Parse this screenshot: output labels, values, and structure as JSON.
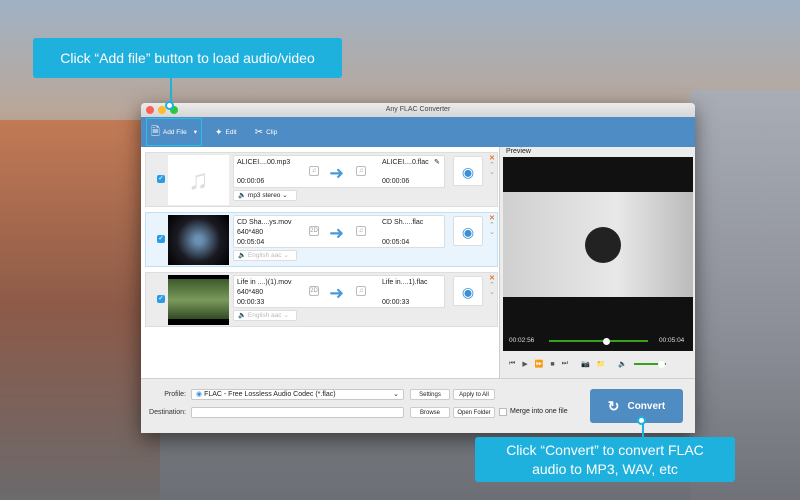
{
  "window": {
    "title": "Any FLAC Converter"
  },
  "toolbar": {
    "add_file": "Add File",
    "edit": "Edit",
    "clip": "Clip"
  },
  "files": [
    {
      "source_name": "ALICEI....00.mp3",
      "source_res": "",
      "source_duration": "00:00:06",
      "output_name": "ALICEI....0.flac",
      "output_duration": "00:00:06",
      "audio_track": "mp3 stereo",
      "checked": true,
      "thumb": "music-note-icon"
    },
    {
      "source_name": "CD Sha....ys.mov",
      "source_res": "640*480",
      "source_duration": "00:05:04",
      "output_name": "CD Sh.....flac",
      "output_duration": "00:05:04",
      "audio_track": "English aac",
      "checked": true,
      "thumb": "video-thumbnail"
    },
    {
      "source_name": "Life in ....)(1).mov",
      "source_res": "640*480",
      "source_duration": "00:00:33",
      "output_name": "Life in....1).flac",
      "output_duration": "00:00:33",
      "audio_track": "English aac",
      "checked": true,
      "thumb": "video-thumbnail"
    }
  ],
  "preview": {
    "label": "Preview",
    "current_time": "00:02:56",
    "total_time": "00:05:04",
    "progress": 0.58,
    "volume": 0.85
  },
  "bottom": {
    "profile_label": "Profile:",
    "profile_value": "FLAC - Free Lossless Audio Codec (*.flac)",
    "settings": "Settings",
    "apply_all": "Apply to All",
    "destination_label": "Destination:",
    "destination_value": "",
    "browse": "Browse",
    "open_folder": "Open Folder",
    "merge": "Merge into one file",
    "convert": "Convert"
  },
  "callouts": {
    "top": "Click “Add file” button to load audio/video",
    "bottom": "Click “Convert” to convert FLAC audio to MP3, WAV, etc"
  },
  "colors": {
    "toolbar": "#4d8cc4",
    "callout": "#1eb1dd",
    "accent": "#2d9ae6",
    "progress": "#3aa11a"
  }
}
